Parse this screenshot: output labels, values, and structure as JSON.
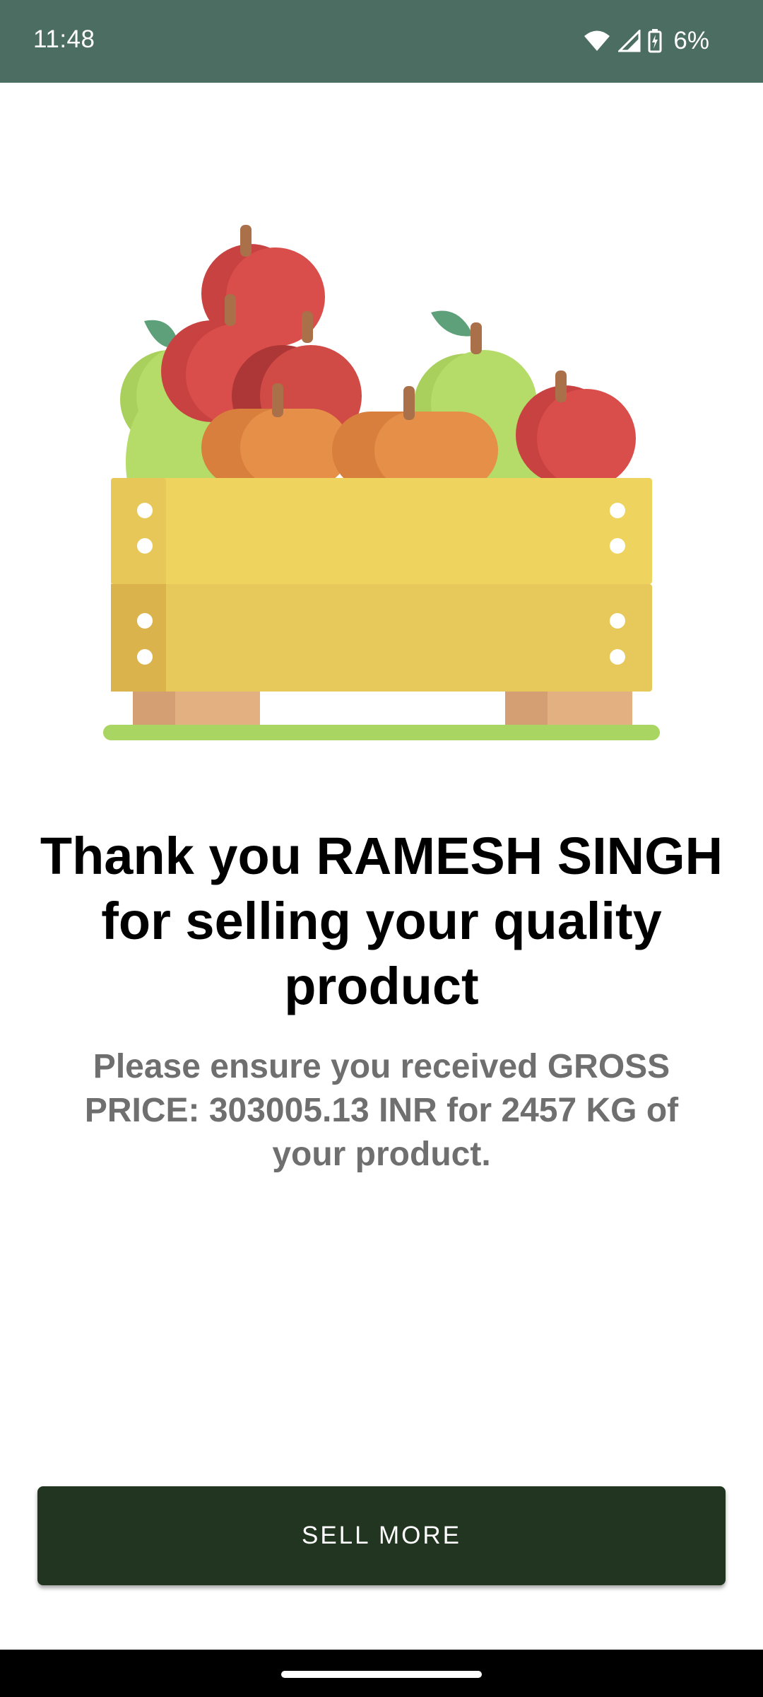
{
  "status_bar": {
    "time": "11:48",
    "battery": "6%",
    "icons": [
      "wifi-icon",
      "cell-signal-icon",
      "battery-charging-icon"
    ]
  },
  "illustration": {
    "icon": "fruit-crate-icon"
  },
  "headline": "Thank you RAMESH SINGH for selling your quality product",
  "subtext": "Please ensure you received GROSS PRICE: 303005.13 INR for 2457 KG of your product.",
  "actions": {
    "sell_more_label": "SELL MORE"
  },
  "colors": {
    "status_bar": "#4c6e62",
    "button": "#213520",
    "subtext": "#6f6f6f"
  }
}
